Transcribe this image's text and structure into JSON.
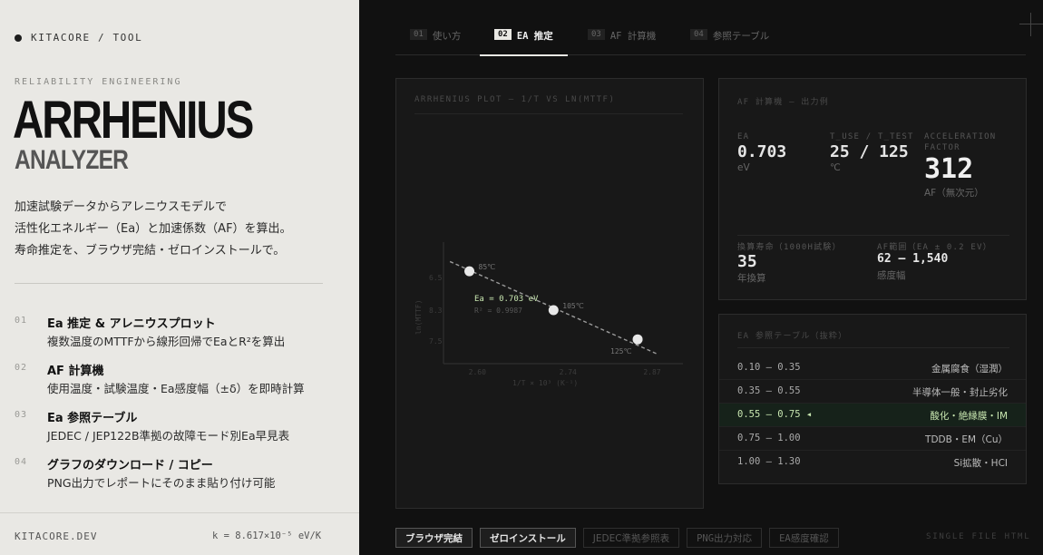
{
  "left": {
    "brand": "KITACORE / TOOL",
    "kicker": "RELIABILITY ENGINEERING",
    "title": "ARRHENIUS",
    "subtitle": "ANALYZER",
    "intro": [
      "加速試験データからアレニウスモデルで",
      "活性化エネルギー（Ea）と加速係数（AF）を算出。",
      "寿命推定を、ブラウザ完結・ゼロインストールで。"
    ],
    "features": [
      {
        "num": "01",
        "title": "Ea 推定 & アレニウスプロット",
        "desc": "複数温度のMTTFから線形回帰でEaとR²を算出"
      },
      {
        "num": "02",
        "title": "AF 計算機",
        "desc": "使用温度・試験温度・Ea感度幅（±δ）を即時計算"
      },
      {
        "num": "03",
        "title": "Ea 参照テーブル",
        "desc": "JEDEC / JEP122B準拠の故障モード別Ea早見表"
      },
      {
        "num": "04",
        "title": "グラフのダウンロード / コピー",
        "desc": "PNG出力でレポートにそのまま貼り付け可能"
      }
    ],
    "footer_left": "KITACORE.DEV",
    "footer_right": "k = 8.617×10⁻⁵ eV/K"
  },
  "tabs": [
    {
      "num": "01",
      "label": "使い方",
      "active": false
    },
    {
      "num": "02",
      "label": "EA 推定",
      "active": true
    },
    {
      "num": "03",
      "label": "AF 計算機",
      "active": false
    },
    {
      "num": "04",
      "label": "参照テーブル",
      "active": false
    }
  ],
  "plot": {
    "title": "ARRHENIUS PLOT — 1/T VS LN(MTTF)",
    "fit_label": "Ea = 0.703 eV",
    "r2_label": "R² = 0.9987"
  },
  "chart_data": {
    "type": "scatter",
    "title": "ARRHENIUS PLOT — 1/T VS LN(MTTF)",
    "xlabel": "1/T × 10³ (K⁻¹)",
    "ylabel": "ln(MTTF)",
    "x_ticks": [
      "2.60",
      "2.74",
      "2.87"
    ],
    "y_ticks": [
      "6.5",
      "8.3",
      "7.5"
    ],
    "xlim": [
      2.55,
      2.92
    ],
    "ylim": [
      6.8,
      9.3
    ],
    "points": [
      {
        "x": 2.59,
        "y": 8.7,
        "label": "85℃"
      },
      {
        "x": 2.72,
        "y": 7.9,
        "label": "105℃"
      },
      {
        "x": 2.85,
        "y": 7.3,
        "label": "125℃"
      }
    ],
    "fit": {
      "ea": "0.703",
      "r2": "0.9987",
      "x": [
        2.56,
        2.88
      ],
      "y": [
        8.9,
        7.0
      ]
    },
    "grid": false
  },
  "af": {
    "title": "AF 計算機 — 出力例",
    "ea_label": "EA",
    "ea_value": "0.703",
    "ea_unit": "eV",
    "temp_label": "T_USE / T_TEST",
    "temp_value": "25 / 125",
    "temp_unit": "℃",
    "af_label": "ACCELERATION FACTOR",
    "af_value": "312",
    "af_unit": "AF（無次元）",
    "life_label": "換算寿命（1000H試験）",
    "life_value": "35",
    "life_unit": "年換算",
    "range_label": "AF範囲（EA ± 0.2 EV）",
    "range_value": "62 – 1,540",
    "range_unit": "感度幅"
  },
  "ref": {
    "title": "EA 参照テーブル（抜粋）",
    "rows": [
      {
        "range": "0.10 – 0.35",
        "mode": "金属腐食（湿潤）",
        "highlight": false
      },
      {
        "range": "0.35 – 0.55",
        "mode": "半導体一般・封止劣化",
        "highlight": false
      },
      {
        "range": "0.55 – 0.75",
        "mode": "酸化・絶縁膜・IM",
        "highlight": true
      },
      {
        "range": "0.75 – 1.00",
        "mode": "TDDB・EM（Cu）",
        "highlight": false
      },
      {
        "range": "1.00 – 1.30",
        "mode": "Si拡散・HCI",
        "highlight": false
      }
    ]
  },
  "badges": [
    {
      "label": "ブラウザ完結",
      "on": true
    },
    {
      "label": "ゼロインストール",
      "on": true
    },
    {
      "label": "JEDEC準拠参照表",
      "on": false
    },
    {
      "label": "PNG出力対応",
      "on": false
    },
    {
      "label": "EA感度確認",
      "on": false
    }
  ],
  "single_file": "SINGLE FILE HTML",
  "colors": {
    "accent_green": "#c8e6b0",
    "panel_bg": "#181818",
    "left_bg": "#e9e8e4"
  }
}
